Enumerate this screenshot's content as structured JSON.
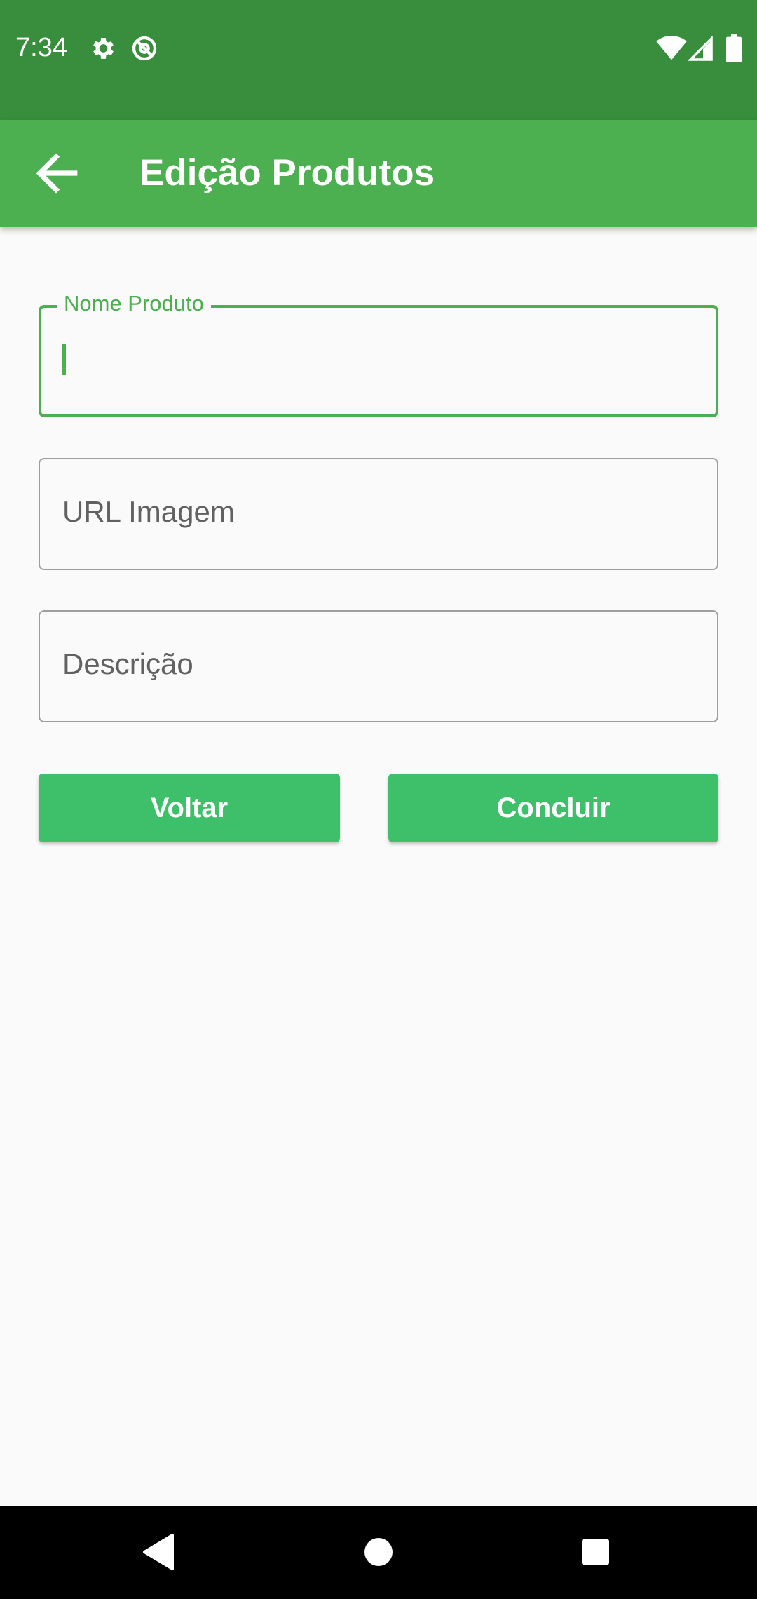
{
  "status_bar": {
    "time": "7:34",
    "icons": [
      "gear-icon",
      "no-sync-icon",
      "wifi-icon",
      "signal-icon",
      "battery-icon"
    ]
  },
  "app_bar": {
    "title": "Edição Produtos",
    "back_icon": "arrow-back-icon"
  },
  "form": {
    "fields": [
      {
        "label": "Nome Produto",
        "value": "",
        "focused": true
      },
      {
        "label": "URL Imagem",
        "value": "",
        "focused": false
      },
      {
        "label": "Descrição",
        "value": "",
        "focused": false
      }
    ],
    "buttons": {
      "back_label": "Voltar",
      "submit_label": "Concluir"
    }
  },
  "nav_bar": {
    "icons": [
      "back-triangle-icon",
      "home-circle-icon",
      "recents-square-icon"
    ]
  },
  "colors": {
    "status_bar": "#388e3c",
    "app_bar": "#4caf50",
    "accent": "#4caf50",
    "button": "#3ec06b",
    "background": "#fafafa"
  }
}
